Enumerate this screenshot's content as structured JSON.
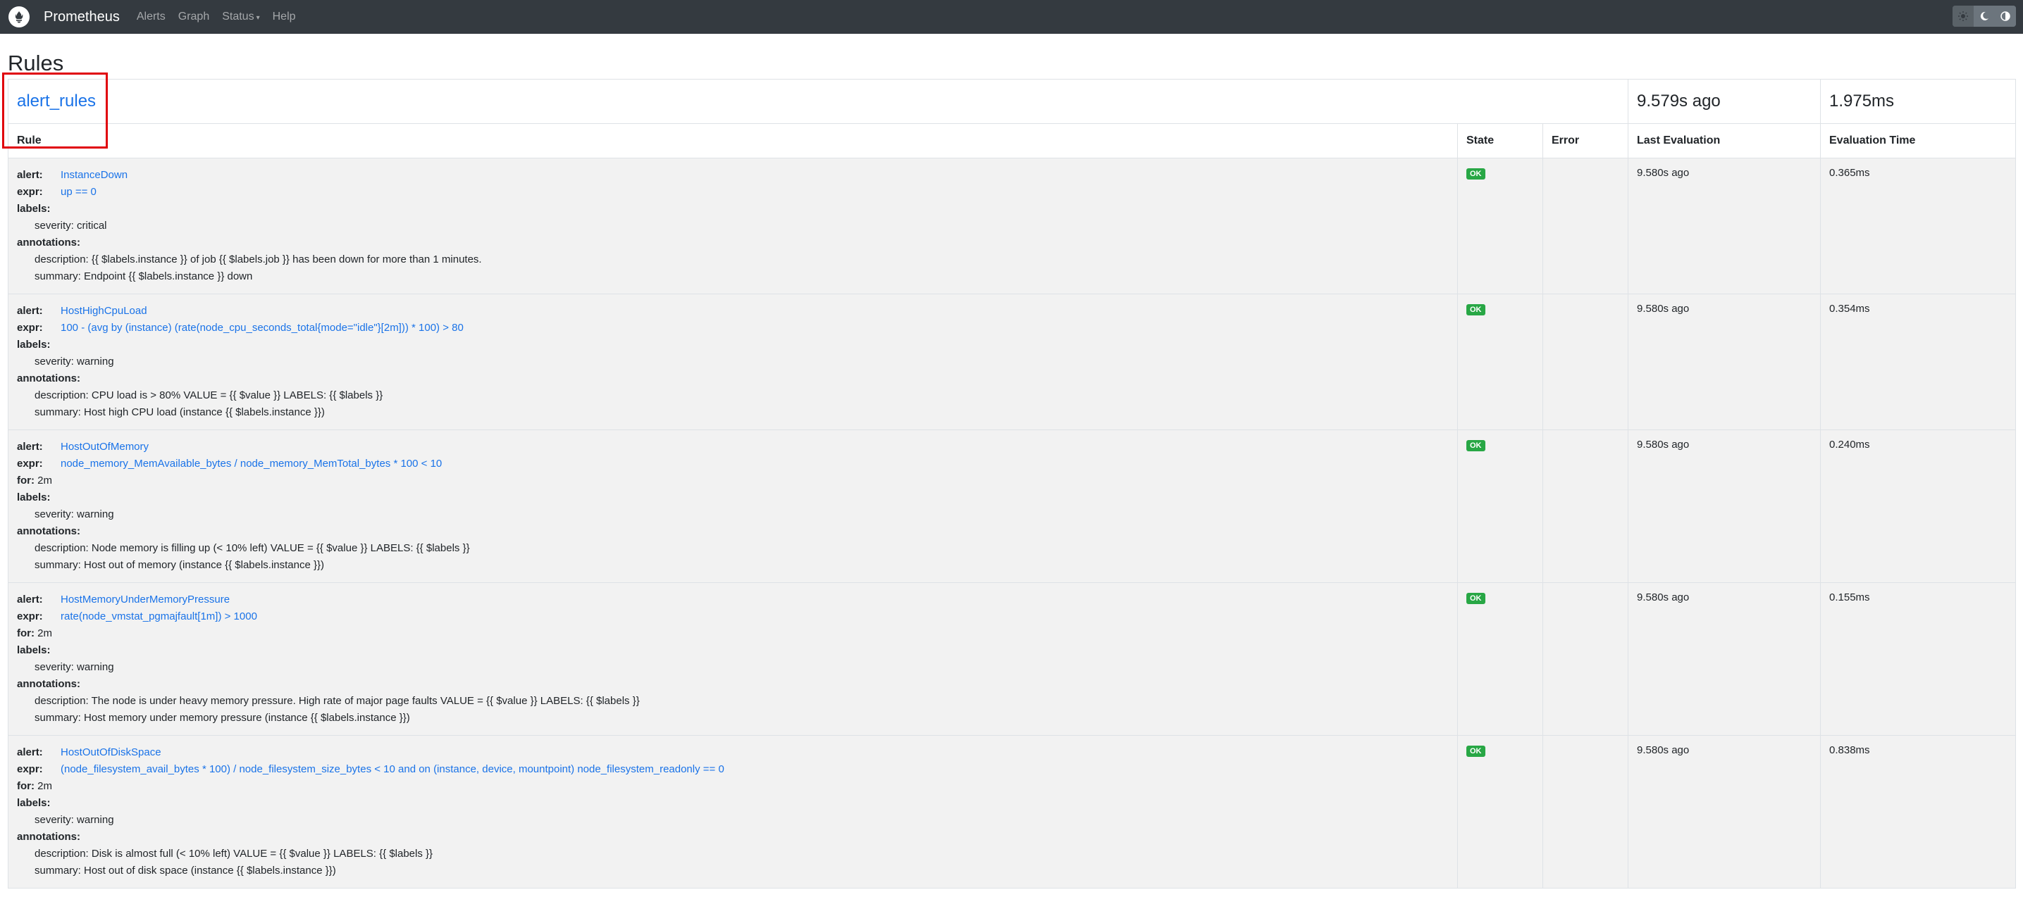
{
  "nav": {
    "brand": "Prometheus",
    "links": [
      "Alerts",
      "Graph",
      "Status",
      "Help"
    ],
    "theme_icons": [
      "sun-icon",
      "moon-icon",
      "half-circle-icon"
    ]
  },
  "page": {
    "title": "Rules"
  },
  "group": {
    "name": "alert_rules",
    "last_evaluation": "9.579s ago",
    "evaluation_time": "1.975ms"
  },
  "columns": {
    "rule": "Rule",
    "state": "State",
    "error": "Error",
    "last_evaluation": "Last Evaluation",
    "evaluation_time": "Evaluation Time"
  },
  "keys": {
    "alert": "alert:",
    "expr": "expr:",
    "for": "for:",
    "labels": "labels:",
    "annotations": "annotations:"
  },
  "rules": [
    {
      "alert": "InstanceDown",
      "expr": "up == 0",
      "for": "",
      "severity": "severity: critical",
      "description": "description: {{ $labels.instance }} of job {{ $labels.job }} has been down for more than 1 minutes.",
      "summary": "summary: Endpoint {{ $labels.instance }} down",
      "state": "OK",
      "error": "",
      "last_evaluation": "9.580s ago",
      "evaluation_time": "0.365ms"
    },
    {
      "alert": "HostHighCpuLoad",
      "expr": "100 - (avg by (instance) (rate(node_cpu_seconds_total{mode=\"idle\"}[2m])) * 100) > 80",
      "for": "",
      "severity": "severity: warning",
      "description": "description: CPU load is > 80% VALUE = {{ $value }} LABELS: {{ $labels }}",
      "summary": "summary: Host high CPU load (instance {{ $labels.instance }})",
      "state": "OK",
      "error": "",
      "last_evaluation": "9.580s ago",
      "evaluation_time": "0.354ms"
    },
    {
      "alert": "HostOutOfMemory",
      "expr": "node_memory_MemAvailable_bytes / node_memory_MemTotal_bytes * 100 < 10",
      "for": "2m",
      "severity": "severity: warning",
      "description": "description: Node memory is filling up (< 10% left) VALUE = {{ $value }} LABELS: {{ $labels }}",
      "summary": "summary: Host out of memory (instance {{ $labels.instance }})",
      "state": "OK",
      "error": "",
      "last_evaluation": "9.580s ago",
      "evaluation_time": "0.240ms"
    },
    {
      "alert": "HostMemoryUnderMemoryPressure",
      "expr": "rate(node_vmstat_pgmajfault[1m]) > 1000",
      "for": "2m",
      "severity": "severity: warning",
      "description": "description: The node is under heavy memory pressure. High rate of major page faults VALUE = {{ $value }} LABELS: {{ $labels }}",
      "summary": "summary: Host memory under memory pressure (instance {{ $labels.instance }})",
      "state": "OK",
      "error": "",
      "last_evaluation": "9.580s ago",
      "evaluation_time": "0.155ms"
    },
    {
      "alert": "HostOutOfDiskSpace",
      "expr": "(node_filesystem_avail_bytes * 100) / node_filesystem_size_bytes < 10 and on (instance, device, mountpoint) node_filesystem_readonly == 0",
      "for": "2m",
      "severity": "severity: warning",
      "description": "description: Disk is almost full (< 10% left) VALUE = {{ $value }} LABELS: {{ $labels }}",
      "summary": "summary: Host out of disk space (instance {{ $labels.instance }})",
      "state": "OK",
      "error": "",
      "last_evaluation": "9.580s ago",
      "evaluation_time": "0.838ms"
    }
  ]
}
